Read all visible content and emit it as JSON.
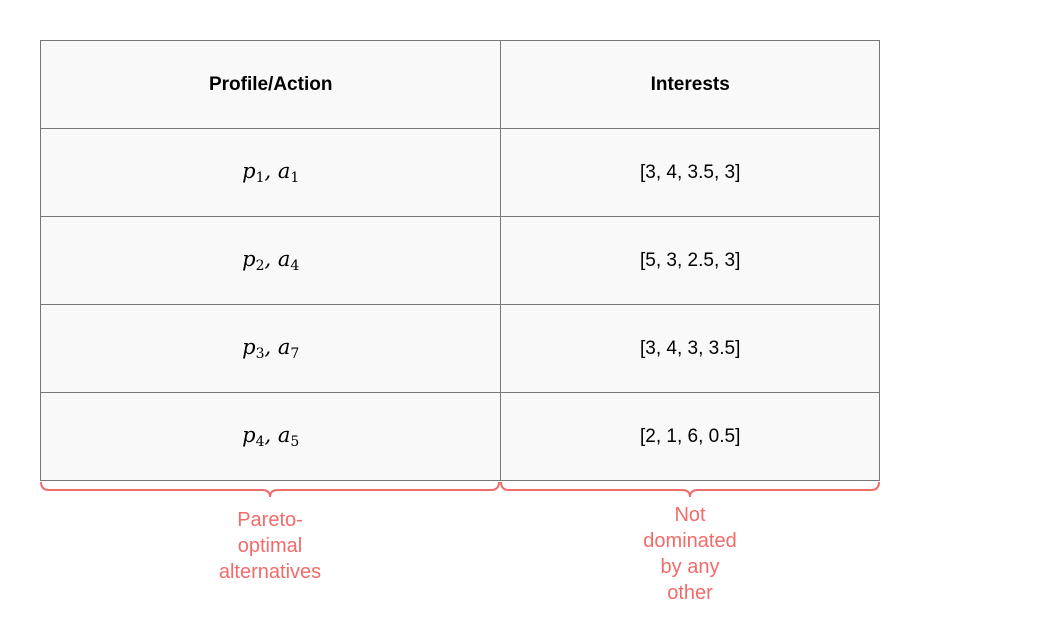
{
  "table": {
    "headers": [
      "Profile/Action",
      "Interests"
    ],
    "rows": [
      {
        "p": "p",
        "p_sub": "1",
        "a": "a",
        "a_sub": "1",
        "interests": "[3, 4, 3.5, 3]"
      },
      {
        "p": "p",
        "p_sub": "2",
        "a": "a",
        "a_sub": "4",
        "interests": "[5, 3, 2.5, 3]"
      },
      {
        "p": "p",
        "p_sub": "3",
        "a": "a",
        "a_sub": "7",
        "interests": "[3, 4, 3, 3.5]"
      },
      {
        "p": "p",
        "p_sub": "4",
        "a": "a",
        "a_sub": "5",
        "interests": "[2, 1, 6, 0.5]"
      }
    ]
  },
  "annotations": {
    "left_lines": [
      "Pareto-",
      "optimal",
      "alternatives"
    ],
    "right_lines": [
      "Not",
      "dominated",
      "by any",
      "other"
    ],
    "color": "#f26b6b"
  }
}
